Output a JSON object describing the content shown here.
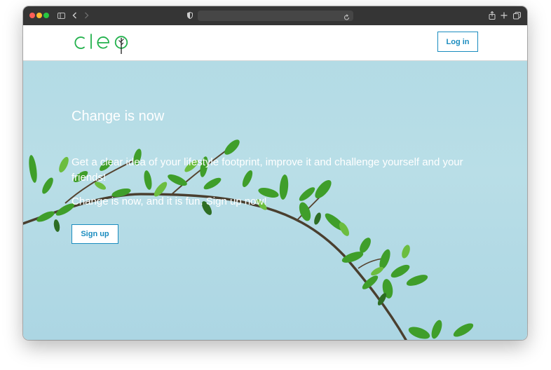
{
  "browser": {
    "address_text": ""
  },
  "header": {
    "logo_text": "cleo",
    "login_label": "Log in"
  },
  "hero": {
    "title": "Change is now",
    "description": "Get a clear idea of your lifestyle footprint, improve it and challenge yourself and your friends!",
    "tagline": "Change is now, and it is fun. Sign up now!",
    "signup_label": "Sign up"
  },
  "colors": {
    "brand_green": "#22b14c",
    "accent_blue": "#1a8cbf",
    "sky": "#b3dbe5"
  }
}
